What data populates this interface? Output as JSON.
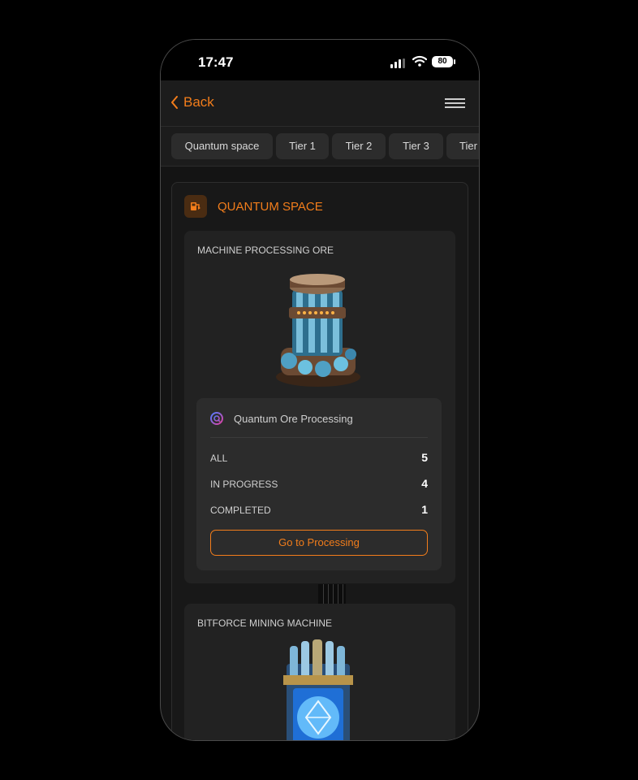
{
  "status_bar": {
    "time": "17:47",
    "battery": "80",
    "icons": [
      "signal-icon",
      "wifi-icon",
      "battery-icon"
    ]
  },
  "navbar": {
    "back_label": "Back",
    "icons": [
      "chevron-left-icon",
      "menu-icon"
    ]
  },
  "tabs": [
    "Quantum space",
    "Tier 1",
    "Tier 2",
    "Tier 3",
    "Tier"
  ],
  "section": {
    "title": "QUANTUM SPACE",
    "icon": "fuel-pump-icon",
    "cards": [
      {
        "title": "MACHINE PROCESSING ORE",
        "image": "ore-processing-machine",
        "stats_title": "Quantum Ore Processing",
        "stats_icon": "quantum-q-icon",
        "rows": [
          {
            "label": "ALL",
            "value": "5"
          },
          {
            "label": "IN PROGRESS",
            "value": "4"
          },
          {
            "label": "COMPLETED",
            "value": "1"
          }
        ],
        "button": "Go to Processing"
      },
      {
        "title": "BITFORCE MINING MACHINE",
        "image": "bitforce-mining-machine"
      }
    ]
  },
  "colors": {
    "accent": "#f27d1b",
    "background": "#000000",
    "panel": "#1c1c1c",
    "card": "#222222"
  }
}
